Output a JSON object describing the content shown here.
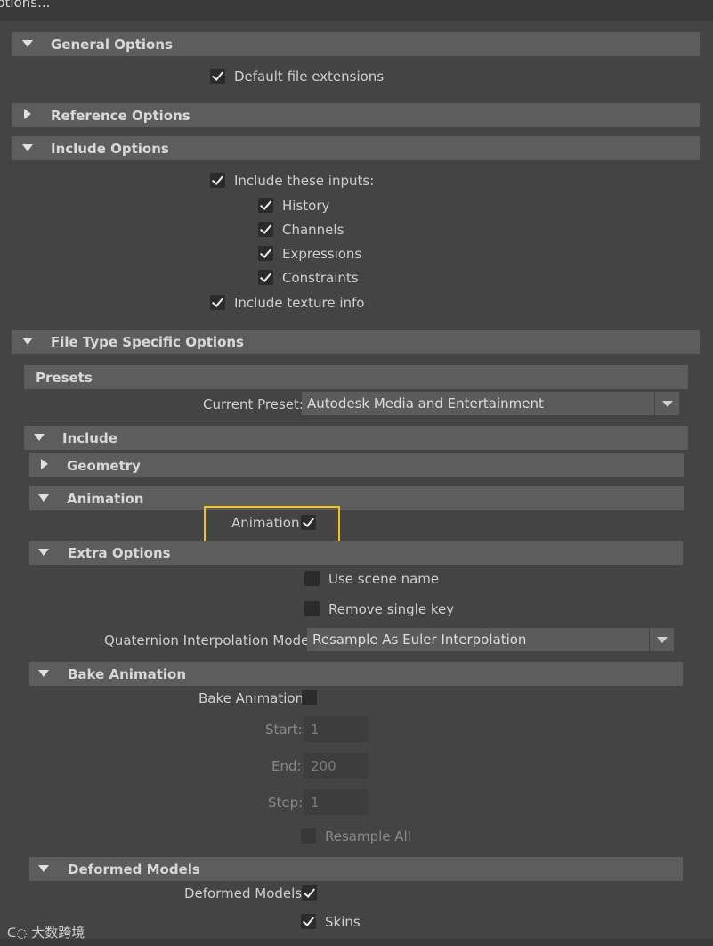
{
  "window": {
    "title_fragment": "ptions..."
  },
  "sections": {
    "general": "General Options",
    "reference": "Reference Options",
    "include_options": "Include Options",
    "file_type": "File Type Specific Options",
    "presets": "Presets",
    "include": "Include",
    "geometry": "Geometry",
    "animation": "Animation",
    "extra_options": "Extra Options",
    "bake_animation": "Bake Animation",
    "deformed_models": "Deformed Models"
  },
  "general": {
    "default_ext": "Default file extensions"
  },
  "include_opts": {
    "include_inputs": "Include these inputs:",
    "history": "History",
    "channels": "Channels",
    "expressions": "Expressions",
    "constraints": "Constraints",
    "texture_info": "Include texture info"
  },
  "presets": {
    "label": "Current Preset:",
    "value": "Autodesk Media and Entertainment"
  },
  "animation": {
    "label": "Animation"
  },
  "extra": {
    "use_scene_name": "Use scene name",
    "remove_single_key": "Remove single key",
    "quat_label": "Quaternion Interpolation Mode:",
    "quat_value": "Resample As Euler Interpolation"
  },
  "bake": {
    "label": "Bake Animation",
    "start_label": "Start:",
    "start_value": "1",
    "end_label": "End:",
    "end_value": "200",
    "step_label": "Step:",
    "step_value": "1",
    "resample_all": "Resample All"
  },
  "deformed": {
    "label": "Deformed Models",
    "skins": "Skins"
  },
  "watermark": "大数跨境",
  "colors": {
    "highlight": "#f3c21b",
    "section_bg": "#5d5d5d",
    "panel_bg": "#444444"
  }
}
